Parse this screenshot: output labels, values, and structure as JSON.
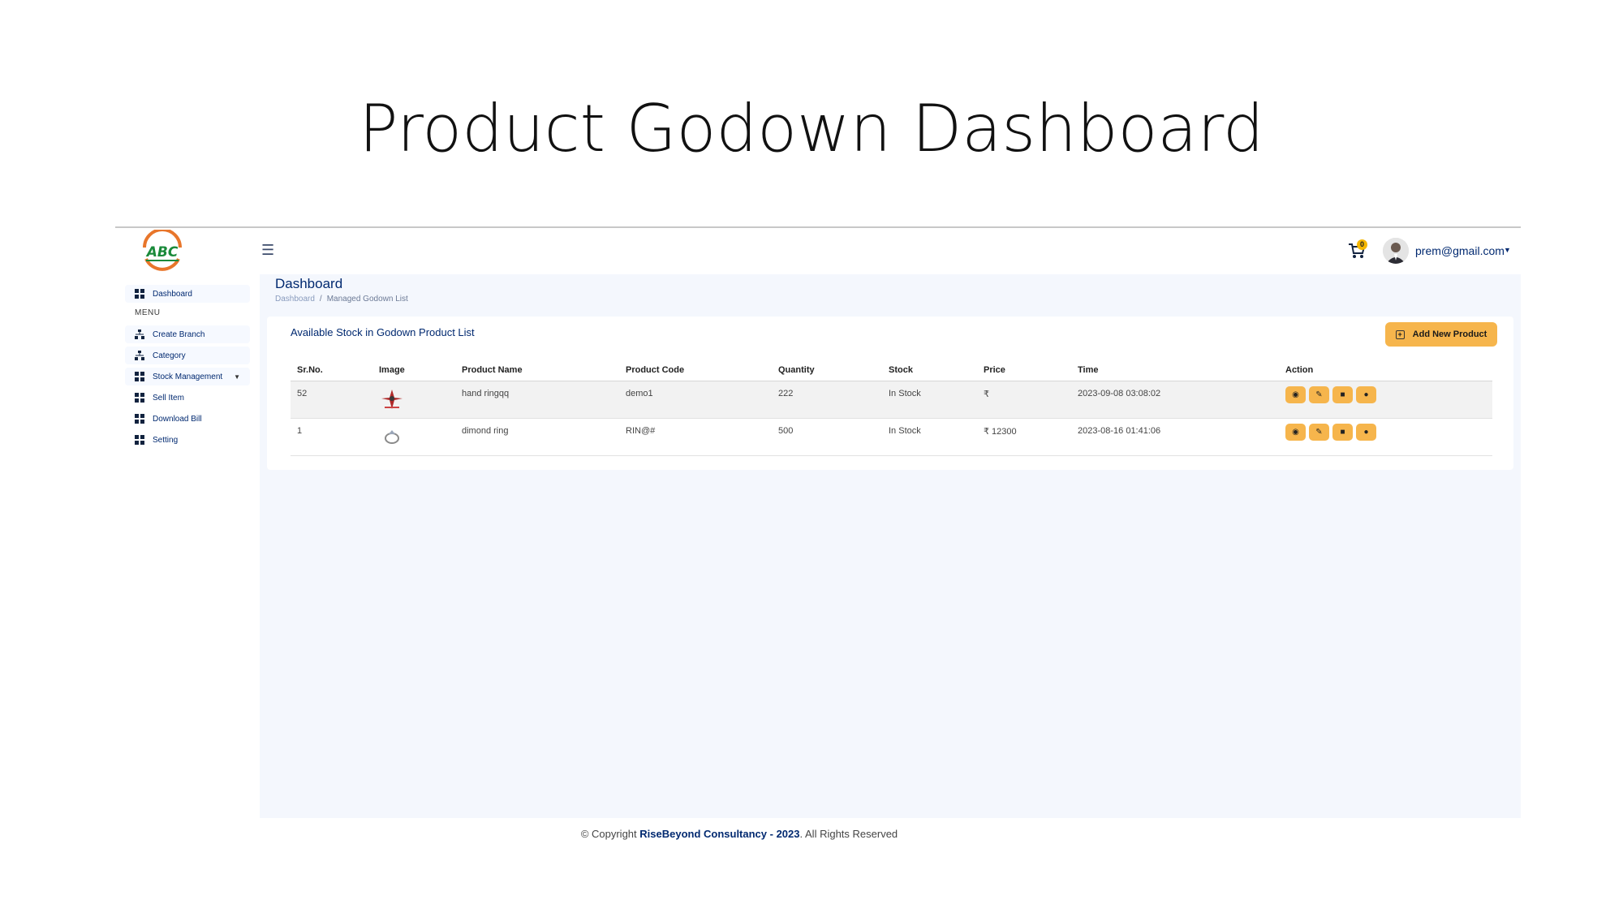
{
  "slide": {
    "title": "Product Godown Dashboard"
  },
  "header": {
    "cart_count": "0",
    "user_email": "prem@gmail.com"
  },
  "sidebar": {
    "menu_heading": "MENU",
    "items": [
      {
        "label": "Dashboard",
        "icon": "grid-icon"
      },
      {
        "label": "Create Branch",
        "icon": "sitemap-icon"
      },
      {
        "label": "Category",
        "icon": "sitemap-icon"
      },
      {
        "label": "Stock Management",
        "icon": "grid-icon"
      },
      {
        "label": "Sell Item",
        "icon": "grid-icon"
      },
      {
        "label": "Download Bill",
        "icon": "grid-icon"
      },
      {
        "label": "Setting",
        "icon": "grid-icon"
      }
    ]
  },
  "page": {
    "title": "Dashboard",
    "breadcrumb": [
      "Dashboard",
      "/",
      "Managed Godown List"
    ]
  },
  "card": {
    "title": "Available Stock in Godown Product List",
    "add_button": "Add New Product",
    "columns": [
      "Sr.No.",
      "Image",
      "Product Name",
      "Product Code",
      "Quantity",
      "Stock",
      "Price",
      "Time",
      "Action"
    ],
    "rows": [
      {
        "sr": "52",
        "name": "hand ringqq",
        "code": "demo1",
        "qty": "222",
        "stock": "In Stock",
        "price": "₹",
        "time": "2023-09-08 03:08:02"
      },
      {
        "sr": "1",
        "name": "dimond ring",
        "code": "RIN@#",
        "qty": "500",
        "stock": "In Stock",
        "price": "₹ 12300",
        "time": "2023-08-16 01:41:06"
      }
    ],
    "action_icons": [
      "eye-icon",
      "edit-icon",
      "trash-icon",
      "compass-icon"
    ]
  },
  "footer": {
    "prefix": "© Copyright ",
    "company": "RiseBeyond Consultancy - 2023",
    "suffix": ". All Rights Reserved"
  },
  "colors": {
    "accent": "#f6b54c",
    "navy": "#012970",
    "content_bg": "#f4f7fd"
  }
}
